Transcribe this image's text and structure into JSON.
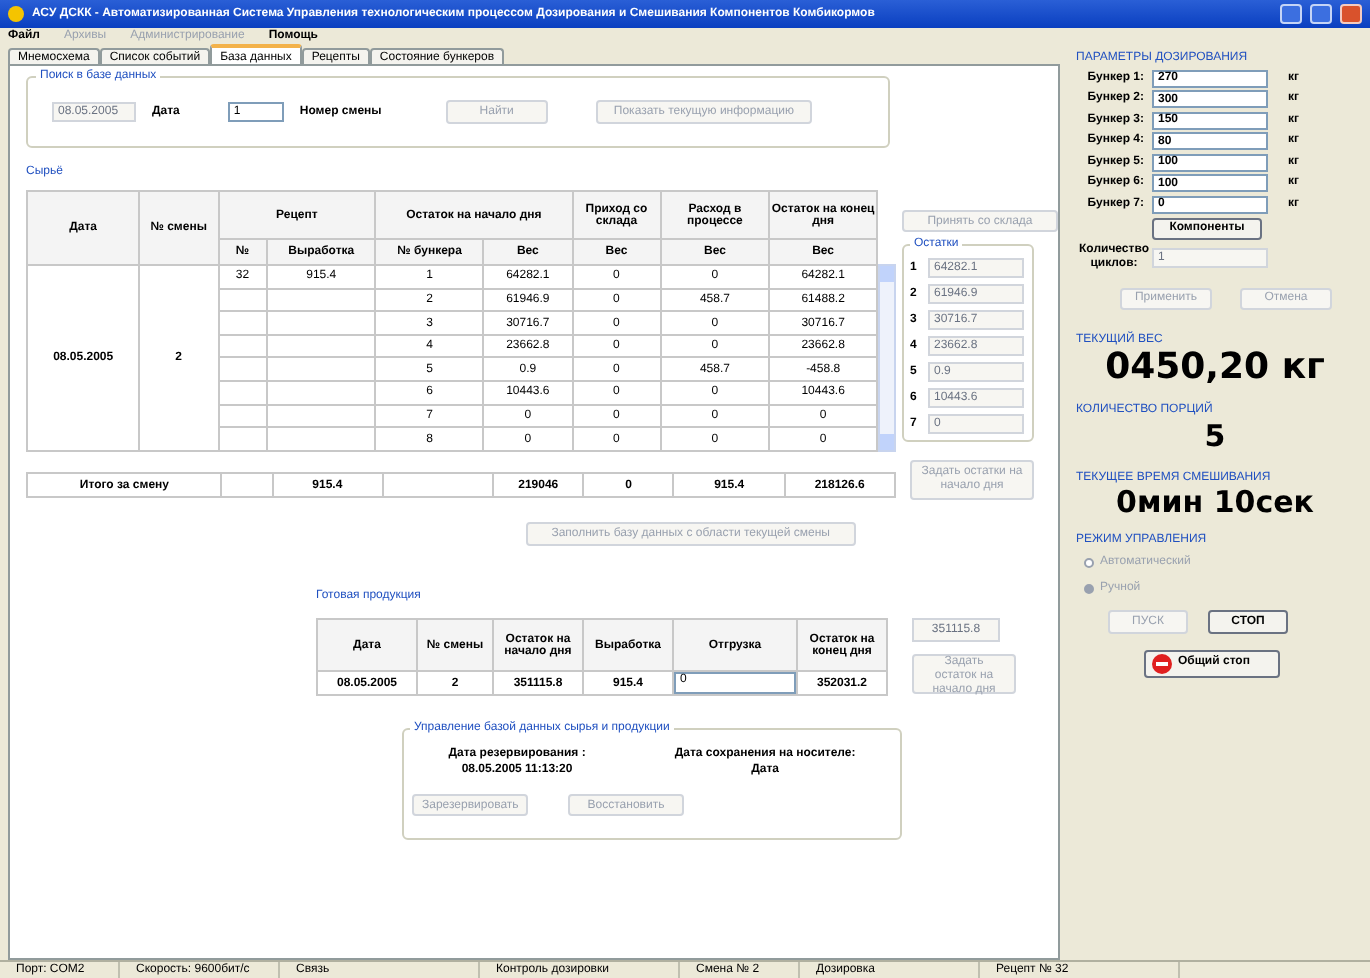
{
  "window": {
    "title": "АСУ ДСКК - Автоматизированная Система Управления технологическим процессом Дозирования и Смешивания Компонентов Комбикормов"
  },
  "menu": [
    {
      "label": "Файл",
      "disabled": false
    },
    {
      "label": "Архивы",
      "disabled": true
    },
    {
      "label": "Администрирование",
      "disabled": true
    },
    {
      "label": "Помощь",
      "disabled": false
    }
  ],
  "tabs": [
    {
      "label": "Мнемосхема",
      "selected": false
    },
    {
      "label": "Список событий",
      "selected": false
    },
    {
      "label": "База данных",
      "selected": true
    },
    {
      "label": "Рецепты",
      "selected": false
    },
    {
      "label": "Состояние бункеров",
      "selected": false
    }
  ],
  "search": {
    "title": "Поиск в базе данных",
    "date": {
      "value": "08.05.2005",
      "disabled": true
    },
    "date_label": "Дата",
    "shift": {
      "value": "1",
      "disabled": false
    },
    "shift_label": "Номер смены",
    "buttons": [
      {
        "label": "Найти",
        "disabled": true
      },
      {
        "label": "Показать текущую информацию",
        "disabled": true
      }
    ]
  },
  "raw": {
    "title": "Сырьё",
    "headers": {
      "date": "Дата",
      "shift": "№ смены",
      "recipe": "Рецепт",
      "recipe_no": "№",
      "output": "Выработка",
      "start": "Остаток на начало дня",
      "bunker": "№ бункера",
      "weight_start": "Вес",
      "weight_income": "Вес",
      "weight_expense": "Вес",
      "weight_end": "Вес",
      "income": "Приход со склада",
      "expense": "Расход в процессе",
      "end": "Остаток на конец дня"
    },
    "date": "08.05.2005",
    "shift": "2",
    "recipe_no": "32",
    "output": "915.4",
    "bunkers": [
      {
        "no": "1",
        "start": "64282.1",
        "income": "0",
        "expense": "0",
        "end": "64282.1"
      },
      {
        "no": "2",
        "start": "61946.9",
        "income": "0",
        "expense": "458.7",
        "end": "61488.2"
      },
      {
        "no": "3",
        "start": "30716.7",
        "income": "0",
        "expense": "0",
        "end": "30716.7"
      },
      {
        "no": "4",
        "start": "23662.8",
        "income": "0",
        "expense": "0",
        "end": "23662.8"
      },
      {
        "no": "5",
        "start": "0.9",
        "income": "0",
        "expense": "458.7",
        "end": "-458.8"
      },
      {
        "no": "6",
        "start": "10443.6",
        "income": "0",
        "expense": "0",
        "end": "10443.6"
      },
      {
        "no": "7",
        "start": "0",
        "income": "0",
        "expense": "0",
        "end": "0"
      },
      {
        "no": "8",
        "start": "0",
        "income": "0",
        "expense": "0",
        "end": "0"
      }
    ],
    "totals": {
      "label": "Итого за смену",
      "output": "915.4",
      "start": "219046",
      "income": "0",
      "expense": "915.4",
      "end": "218126.6"
    }
  },
  "fill_button": {
    "label": "Заполнить базу данных с области текущей смены",
    "disabled": true
  },
  "receive_button": {
    "label": "Принять со склада",
    "disabled": true
  },
  "remains": {
    "title": "Остатки",
    "items": [
      {
        "no": "1",
        "value": "64282.1"
      },
      {
        "no": "2",
        "value": "61946.9"
      },
      {
        "no": "3",
        "value": "30716.7"
      },
      {
        "no": "4",
        "value": "23662.8"
      },
      {
        "no": "5",
        "value": "0.9"
      },
      {
        "no": "6",
        "value": "10443.6"
      },
      {
        "no": "7",
        "value": "0"
      }
    ]
  },
  "set_remains_button": {
    "label": "Задать остатки на начало дня",
    "disabled": true
  },
  "product": {
    "title": "Готовая продукция",
    "columns": [
      "Дата",
      "№ смены",
      "Остаток на начало дня",
      "Выработка",
      "Отгрузка",
      "Остаток на конец дня"
    ],
    "row": {
      "date": "08.05.2005",
      "shift": "2",
      "start": "351115.8",
      "output": "915.4",
      "shipment": "0",
      "end": "352031.2"
    }
  },
  "product_remain_field": {
    "value": "351115.8",
    "disabled": true
  },
  "product_set_button": {
    "label": "Задать остаток на начало дня",
    "disabled": true
  },
  "db_control": {
    "title": "Управление базой данных сырья и продукции",
    "reserve_label": "Дата резервирования :",
    "reserve_date": "08.05.2005 11:13:20",
    "save_label": "Дата сохранения на носителе:",
    "save_date": "Дата",
    "buttons": [
      {
        "label": "Зарезервировать",
        "disabled": true
      },
      {
        "label": "Восстановить",
        "disabled": true
      }
    ]
  },
  "dosing": {
    "title": "ПАРАМЕТРЫ ДОЗИРОВАНИЯ",
    "bunkers": [
      {
        "label": "Бункер 1:",
        "value": "270",
        "unit": "кг"
      },
      {
        "label": "Бункер 2:",
        "value": "300",
        "unit": "кг"
      },
      {
        "label": "Бункер 3:",
        "value": "150",
        "unit": "кг"
      },
      {
        "label": "Бункер 4:",
        "value": "80",
        "unit": "кг"
      },
      {
        "label": "Бункер 5:",
        "value": "100",
        "unit": "кг"
      },
      {
        "label": "Бункер 6:",
        "value": "100",
        "unit": "кг"
      },
      {
        "label": "Бункер 7:",
        "value": "0",
        "unit": "кг"
      }
    ],
    "components_button": {
      "label": "Компоненты",
      "disabled": false
    },
    "cycles_label": "Количество циклов:",
    "cycles_value": "1",
    "buttons": [
      {
        "label": "Применить",
        "disabled": true
      },
      {
        "label": "Отмена",
        "disabled": true
      }
    ]
  },
  "current_weight": {
    "title": "ТЕКУЩИЙ ВЕС",
    "value": "0450,20 кг"
  },
  "portions": {
    "title": "КОЛИЧЕСТВО ПОРЦИЙ",
    "value": "5"
  },
  "mix_time": {
    "title": "ТЕКУЩЕЕ ВРЕМЯ СМЕШИВАНИЯ",
    "value": "0мин 10сек"
  },
  "mode": {
    "title": "РЕЖИМ УПРАВЛЕНИЯ",
    "options": [
      {
        "label": "Автоматический",
        "selected": false,
        "disabled": true
      },
      {
        "label": "Ручной",
        "selected": true,
        "disabled": true
      }
    ],
    "buttons": [
      {
        "label": "ПУСК",
        "disabled": true
      },
      {
        "label": "СТОП",
        "disabled": false
      }
    ]
  },
  "emergency_stop": {
    "label": "Общий стоп"
  },
  "status_bar": [
    "Порт: COM2",
    "Скорость: 9600бит/с",
    "Связь",
    "Контроль дозировки",
    "Смена № 2",
    "Дозировка",
    "Рецепт № 32"
  ]
}
